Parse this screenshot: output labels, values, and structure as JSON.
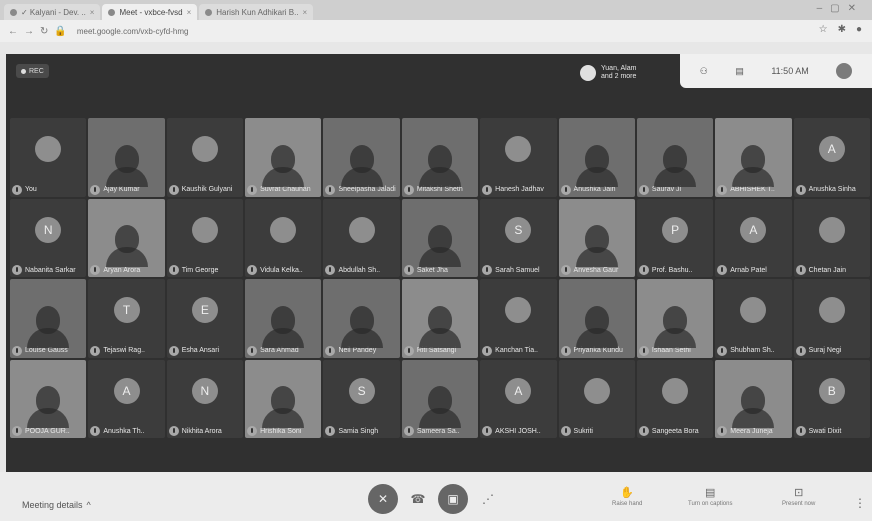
{
  "browser": {
    "tabs": [
      {
        "label": "✓ Kalyani - Dev. .."
      },
      {
        "label": "Meet - vxbce-fvsd"
      },
      {
        "label": "Harish Kun Adhikari B.."
      }
    ],
    "url": "meet.google.com/vxb-cyfd-hmg"
  },
  "meeting": {
    "rec_label": "REC",
    "presenter_line1": "Yuan, Alam",
    "presenter_line2": "and 2 more",
    "time": "11:50 AM"
  },
  "participants": [
    {
      "name": "You",
      "type": "avatar",
      "initial": ""
    },
    {
      "name": "Ajay Kumar",
      "type": "video",
      "initial": ""
    },
    {
      "name": "Kaushik Gulyani",
      "type": "avatar",
      "initial": ""
    },
    {
      "name": "Suvrat Chauhan",
      "type": "video",
      "initial": ""
    },
    {
      "name": "Sheelpasha Jaladi",
      "type": "video",
      "initial": ""
    },
    {
      "name": "Mitakshi Sheth",
      "type": "video",
      "initial": ""
    },
    {
      "name": "Hanesh Jadhav",
      "type": "avatar",
      "initial": ""
    },
    {
      "name": "Anushka Jain",
      "type": "video",
      "initial": ""
    },
    {
      "name": "Saurav Ji",
      "type": "video",
      "initial": ""
    },
    {
      "name": "ABHISHEK T..",
      "type": "video",
      "initial": ""
    },
    {
      "name": "Anushka Sinha",
      "type": "avatar",
      "initial": "A"
    },
    {
      "name": "Nabanita Sarkar",
      "type": "avatar",
      "initial": "N"
    },
    {
      "name": "Aryan Arora",
      "type": "video",
      "initial": ""
    },
    {
      "name": "Tim George",
      "type": "avatar",
      "initial": ""
    },
    {
      "name": "Vidula Kelka..",
      "type": "avatar",
      "initial": ""
    },
    {
      "name": "Abdullah Sh..",
      "type": "avatar",
      "initial": ""
    },
    {
      "name": "Saket Jha",
      "type": "video",
      "initial": ""
    },
    {
      "name": "Sarah Samuel",
      "type": "avatar",
      "initial": "S"
    },
    {
      "name": "Anvesha Gaur",
      "type": "video",
      "initial": ""
    },
    {
      "name": "Prof. Bashu..",
      "type": "avatar",
      "initial": "P"
    },
    {
      "name": "Arnab Patel",
      "type": "avatar",
      "initial": "A"
    },
    {
      "name": "Chetan Jain",
      "type": "avatar",
      "initial": ""
    },
    {
      "name": "Louise Gauss",
      "type": "video",
      "initial": ""
    },
    {
      "name": "Tejaswi Rag..",
      "type": "avatar",
      "initial": "T"
    },
    {
      "name": "Esha Ansari",
      "type": "avatar",
      "initial": "E"
    },
    {
      "name": "Sara Ahmad",
      "type": "video",
      "initial": ""
    },
    {
      "name": "Neil Pandey",
      "type": "video",
      "initial": ""
    },
    {
      "name": "Riti Satsangi",
      "type": "video",
      "initial": ""
    },
    {
      "name": "Kanchan Tia..",
      "type": "avatar",
      "initial": ""
    },
    {
      "name": "Priyanka Kundu",
      "type": "video",
      "initial": ""
    },
    {
      "name": "Ishaan Sethi",
      "type": "video",
      "initial": ""
    },
    {
      "name": "Shubham Sh..",
      "type": "avatar",
      "initial": ""
    },
    {
      "name": "Suraj Negi",
      "type": "avatar",
      "initial": ""
    },
    {
      "name": "POOJA GUR..",
      "type": "video",
      "initial": ""
    },
    {
      "name": "Anushka Th..",
      "type": "avatar",
      "initial": "A"
    },
    {
      "name": "Nikhita Arora",
      "type": "avatar",
      "initial": "N"
    },
    {
      "name": "Hrishika Soni",
      "type": "video",
      "initial": ""
    },
    {
      "name": "Samia Singh",
      "type": "avatar",
      "initial": "S"
    },
    {
      "name": "Sameera Sa..",
      "type": "video",
      "initial": ""
    },
    {
      "name": "AKSHI JOSH..",
      "type": "avatar",
      "initial": "A"
    },
    {
      "name": "Sukriti",
      "type": "avatar",
      "initial": ""
    },
    {
      "name": "Sangeeta Bora",
      "type": "avatar",
      "initial": ""
    },
    {
      "name": "Meera Juneja",
      "type": "video",
      "initial": ""
    },
    {
      "name": "Swati Dixit",
      "type": "avatar",
      "initial": "B"
    }
  ],
  "toolbar": {
    "meeting_details": "Meeting details",
    "raise_hand": "Raise hand",
    "captions": "Turn on captions",
    "present": "Present now"
  }
}
